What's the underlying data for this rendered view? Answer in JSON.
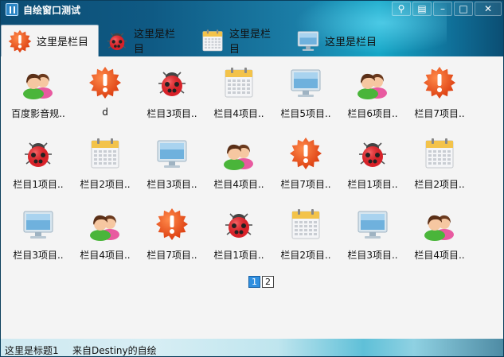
{
  "window": {
    "title": "自绘窗口测试"
  },
  "title_buttons": [
    "⚲",
    "▤",
    "–",
    "□",
    "✕"
  ],
  "tabs": [
    {
      "label": "这里是栏目",
      "icon": "warn-icon",
      "active": true
    },
    {
      "label": "这里是栏目",
      "icon": "bug-icon",
      "active": false
    },
    {
      "label": "这里是栏目",
      "icon": "calendar-icon",
      "active": false
    },
    {
      "label": "这里是栏目",
      "icon": "monitor-icon",
      "active": false
    }
  ],
  "items": [
    {
      "label": "百度影音规..",
      "icon": "user"
    },
    {
      "label": "d",
      "icon": "warn"
    },
    {
      "label": "栏目3项目..",
      "icon": "bug"
    },
    {
      "label": "栏目4项目..",
      "icon": "cal"
    },
    {
      "label": "栏目5项目..",
      "icon": "mon"
    },
    {
      "label": "栏目6项目..",
      "icon": "user"
    },
    {
      "label": "栏目7项目..",
      "icon": "warn"
    },
    {
      "label": "栏目1项目..",
      "icon": "bug"
    },
    {
      "label": "栏目2项目..",
      "icon": "cal"
    },
    {
      "label": "栏目3项目..",
      "icon": "mon"
    },
    {
      "label": "栏目4项目..",
      "icon": "user"
    },
    {
      "label": "栏目7项目..",
      "icon": "warn"
    },
    {
      "label": "栏目1项目..",
      "icon": "bug"
    },
    {
      "label": "栏目2项目..",
      "icon": "cal"
    },
    {
      "label": "栏目3项目..",
      "icon": "mon"
    },
    {
      "label": "栏目4项目..",
      "icon": "user"
    },
    {
      "label": "栏目7项目..",
      "icon": "warn"
    },
    {
      "label": "栏目1项目..",
      "icon": "bug"
    },
    {
      "label": "栏目2项目..",
      "icon": "cal"
    },
    {
      "label": "栏目3项目..",
      "icon": "mon"
    },
    {
      "label": "栏目4项目..",
      "icon": "user"
    }
  ],
  "pager": {
    "pages": [
      "1",
      "2"
    ],
    "current": "1"
  },
  "status": {
    "left": "这里是标题1",
    "right": "来自Destiny的自绘"
  }
}
